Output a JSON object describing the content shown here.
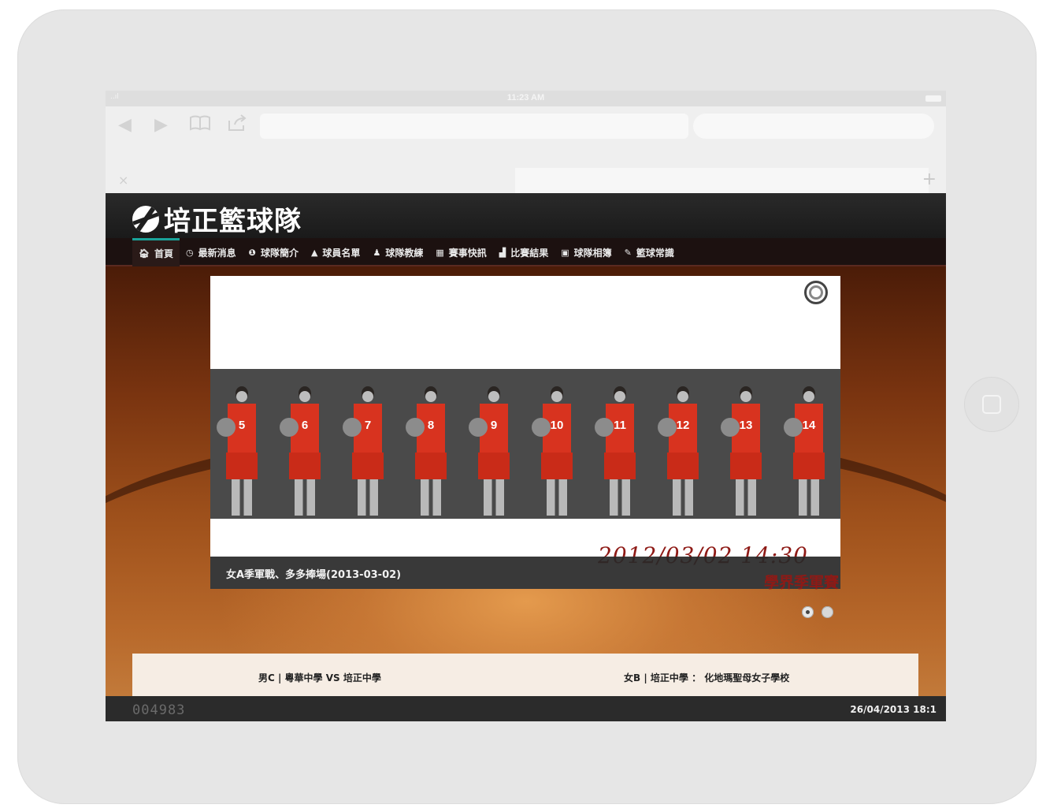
{
  "device": {
    "status_time": "11:23 AM",
    "signal_label": "..ıl"
  },
  "browser": {
    "back_icon": "◀",
    "forward_icon": "▶",
    "bookmarks_icon": "book-icon",
    "share_icon": "share-icon",
    "address": "",
    "search": "",
    "tab_close": "×",
    "new_tab": "+"
  },
  "site": {
    "title": "培正籃球隊",
    "nav": [
      {
        "icon": "🏠︎",
        "label": "首頁"
      },
      {
        "icon": "◷",
        "label": "最新消息"
      },
      {
        "icon": "❶",
        "label": "球隊簡介"
      },
      {
        "icon": "▲",
        "label": "球員名單"
      },
      {
        "icon": "♟",
        "label": "球隊教練"
      },
      {
        "icon": "▦",
        "label": "賽事快訊"
      },
      {
        "icon": "▟",
        "label": "比賽結果"
      },
      {
        "icon": "▣",
        "label": "球隊相簿"
      },
      {
        "icon": "✎",
        "label": "籃球常識"
      }
    ],
    "slider": {
      "date_stamp": "2012/03/02  14:30",
      "caption": "女A季軍戰、多多捧場(2013-03-02)",
      "caption_sub": "學界季軍賽",
      "jersey_numbers": [
        "5",
        "6",
        "7",
        "8",
        "9",
        "10",
        "11",
        "12",
        "13",
        "14"
      ],
      "slides": 2,
      "active_slide": 1
    },
    "ticker": {
      "match1": "男C | 粵華中學 VS 培正中學",
      "match2": "女B | 培正中學 ： 化地瑪聖母女子學校"
    },
    "footer": {
      "counter": "004983",
      "datetime": "26/04/2013 18:1"
    }
  },
  "colors": {
    "accent": "#1aa39a",
    "jersey": "#d8331f",
    "header_bg": "#1f1f1f",
    "date_red": "#8e1a16"
  }
}
